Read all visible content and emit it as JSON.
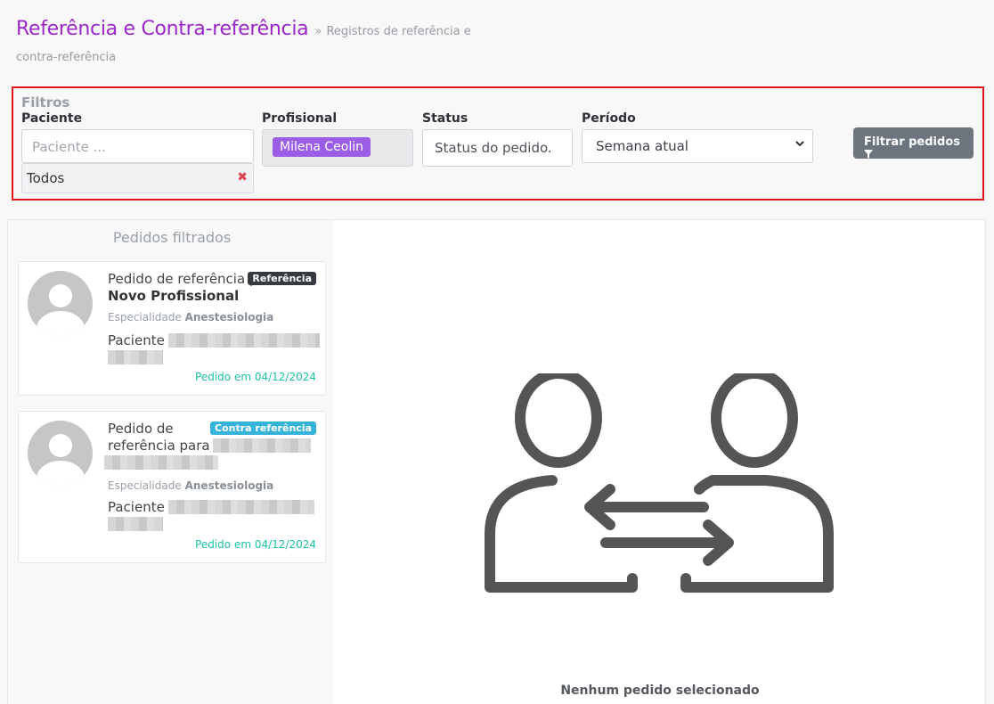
{
  "header": {
    "title": "Referência e Contra-referência",
    "separator": "»",
    "breadcrumb": "Registros de referência e",
    "breadcrumb_cont": "contra-referência"
  },
  "filters": {
    "section_title": "Filtros",
    "paciente": {
      "label": "Paciente",
      "placeholder": "Paciente ...",
      "selected": "Todos"
    },
    "profissional": {
      "label": "Profisional",
      "selected_chip": "Milena Ceolin"
    },
    "status": {
      "label": "Status",
      "placeholder": "Status do pedido."
    },
    "periodo": {
      "label": "Período",
      "selected": "Semana atual"
    },
    "submit_label": "Filtrar pedidos"
  },
  "results": {
    "title": "Pedidos filtrados",
    "items": [
      {
        "title_prefix": "Pedido de referência para",
        "title_name": "Novo Profissional",
        "badge": "Referência",
        "spec_label": "Especialidade",
        "spec_value": "Anestesiologia",
        "patient_label": "Paciente",
        "date": "Pedido em 04/12/2024"
      },
      {
        "title_prefix": "Pedido de referência para",
        "badge": "Contra referência",
        "spec_label": "Especialidade",
        "spec_value": "Anestesiologia",
        "patient_label": "Paciente",
        "date": "Pedido em 04/12/2024"
      }
    ]
  },
  "detail": {
    "empty_text": "Nenhum pedido selecionado"
  },
  "colors": {
    "title": "#9b27c8",
    "chip": "#9b5de5",
    "highlight_border": "#e1141c",
    "badge_referencia": "#343a40",
    "badge_contra": "#36b3d9",
    "date": "#1cc3a5"
  },
  "icons": [
    "close-icon",
    "chevron-down-icon",
    "filter-icon",
    "avatar-placeholder-icon",
    "exchange-people-icon"
  ]
}
